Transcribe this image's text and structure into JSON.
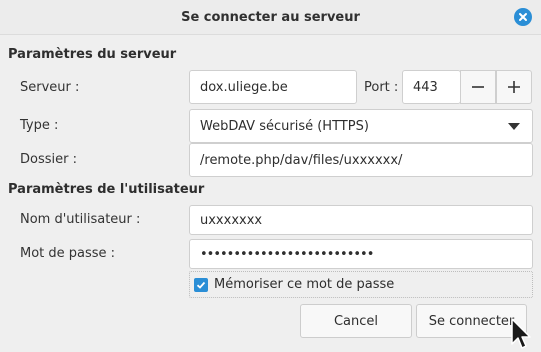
{
  "window": {
    "title": "Se connecter au serveur"
  },
  "server_section": {
    "heading": "Paramètres du serveur",
    "server_label": "Serveur :",
    "server_value": "dox.uliege.be",
    "port_label": "Port :",
    "port_value": "443",
    "type_label": "Type :",
    "type_value": "WebDAV sécurisé (HTTPS)",
    "folder_label": "Dossier :",
    "folder_value": "/remote.php/dav/files/uxxxxxx/"
  },
  "user_section": {
    "heading": "Paramètres de l'utilisateur",
    "username_label": "Nom d'utilisateur :",
    "username_value": "uxxxxxxx",
    "password_label": "Mot de passe :",
    "password_value": "••••••••••••••••••••••••••",
    "remember_label": "Mémoriser ce mot de passe",
    "remember_checked": true
  },
  "buttons": {
    "cancel": "Cancel",
    "connect": "Se connecter"
  },
  "icons": {
    "close": "close-icon",
    "minus": "minus-icon",
    "plus": "plus-icon",
    "dropdown": "chevron-down-icon",
    "check": "check-icon",
    "cursor": "mouse-pointer-icon"
  },
  "colors": {
    "accent": "#2a8ed6"
  }
}
